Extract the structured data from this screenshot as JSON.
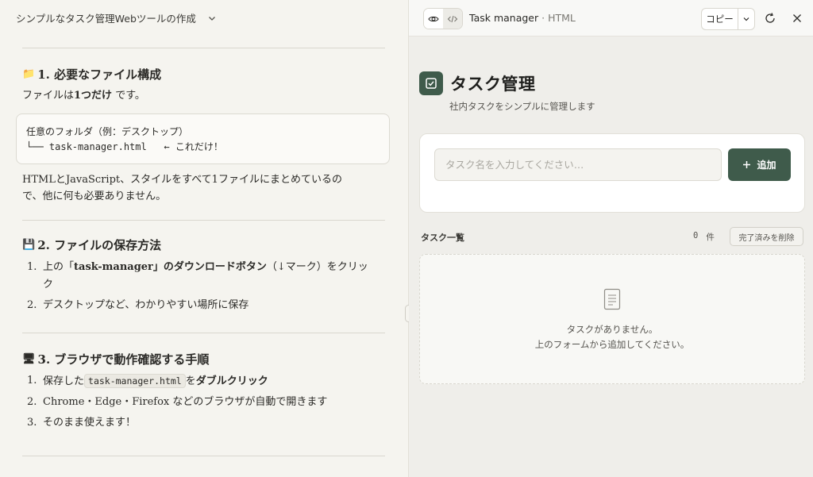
{
  "chat": {
    "title": "シンプルなタスク管理Webツールの作成",
    "sections": {
      "s1": {
        "emoji": "📁",
        "heading": "1. 必要なファイル構成",
        "intro_pre": "ファイルは",
        "intro_bold": "1つだけ",
        "intro_post": " です。",
        "code_line1": "任意のフォルダ（例：デスクトップ）",
        "code_line2": "└── task-manager.html   ← これだけ！",
        "para_line1": "HTMLとJavaScript、スタイルをすべて1ファイルにまとめているの",
        "para_line2": "で、他に何も必要ありません。"
      },
      "s2": {
        "emoji": "💾",
        "heading": "2. ファイルの保存方法",
        "items": [
          {
            "num": "1.",
            "pre": "上の「",
            "bold": "task-manager」のダウンロードボタン",
            "post": "（↓マーク）をクリック"
          },
          {
            "num": "2.",
            "text": "デスクトップなど、わかりやすい場所に保存"
          }
        ]
      },
      "s3": {
        "emoji": "🖥",
        "heading": "3. ブラウザで動作確認する手順",
        "items": [
          {
            "num": "1.",
            "pre": "保存した",
            "code": "task-manager.html",
            "mid": "を",
            "bold": "ダブルクリック"
          },
          {
            "num": "2.",
            "text": "Chrome・Edge・Firefox などのブラウザが自動で開きます"
          },
          {
            "num": "3.",
            "text": "そのまま使えます！"
          }
        ]
      }
    }
  },
  "artifact": {
    "name": "Task manager",
    "sep": " · ",
    "type": "HTML",
    "copy_label": "コピー",
    "icons": [
      "eye-icon",
      "code-icon",
      "chevron-down-icon",
      "refresh-icon",
      "close-icon"
    ]
  },
  "app": {
    "title": "タスク管理",
    "subtitle": "社内タスクをシンプルに管理します",
    "input_placeholder": "タスク名を入力してください…",
    "add_label": "追加",
    "list_label": "タスク一覧",
    "count_value": "0",
    "count_unit": "件",
    "clear_label": "完了済みを削除",
    "empty_line1": "タスクがありません。",
    "empty_line2": "上のフォームから追加してください。"
  },
  "colors": {
    "accent": "#3f5b4b",
    "background": "#f5f4ef",
    "panel": "#efeeea"
  }
}
